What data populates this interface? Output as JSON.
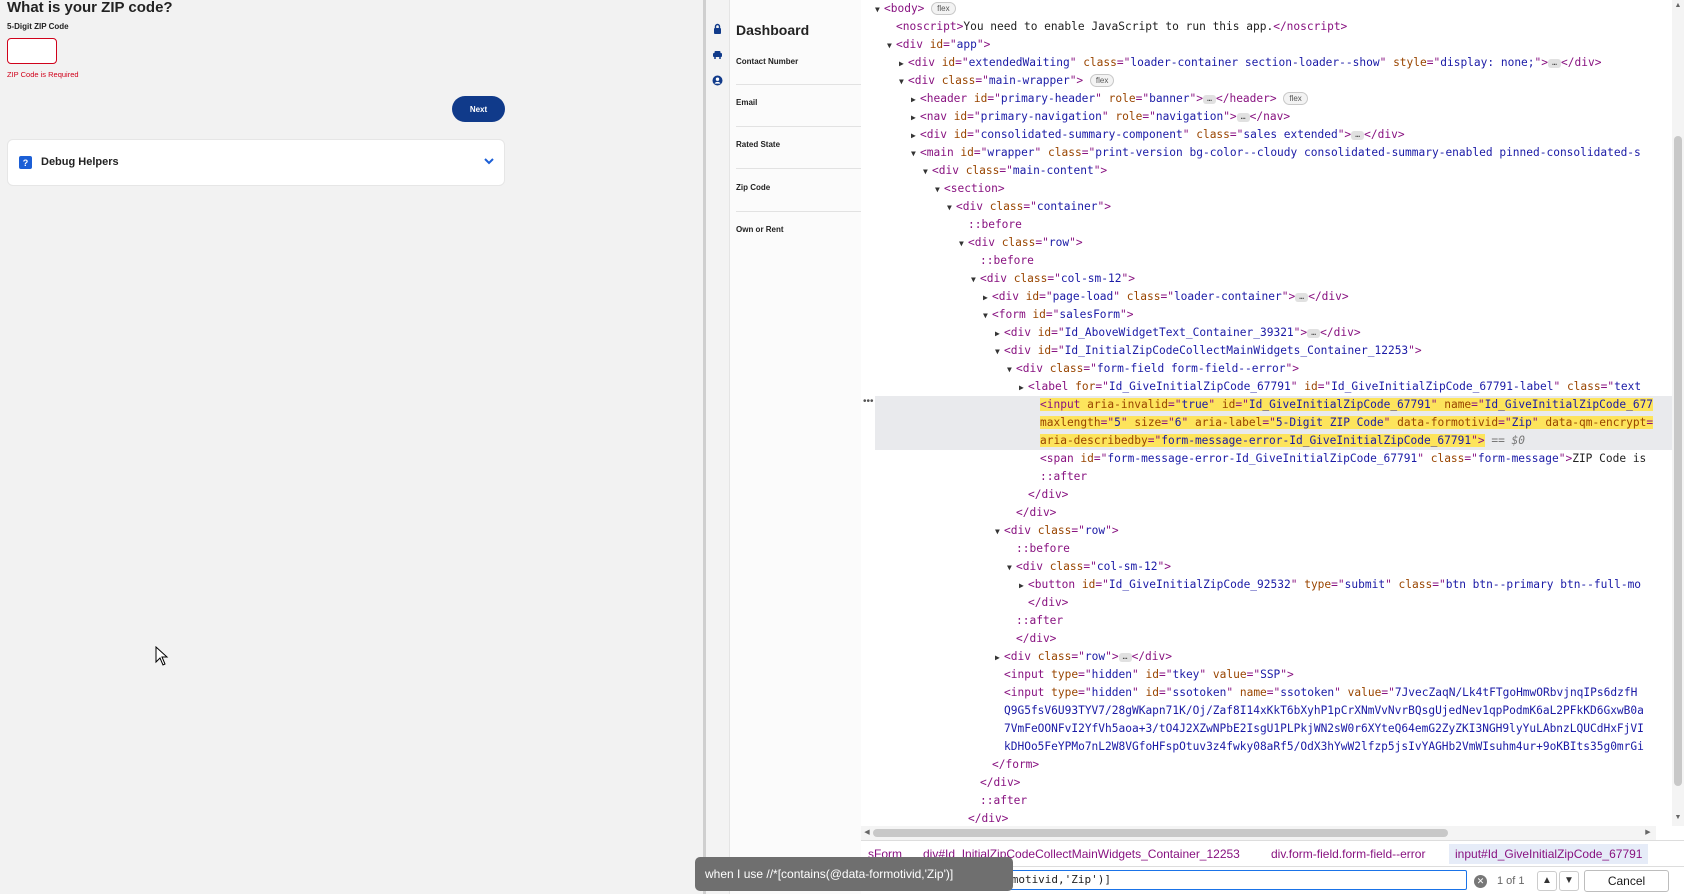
{
  "zip_form": {
    "title": "What is your ZIP code?",
    "field_label": "5-Digit ZIP Code",
    "input_value": "",
    "error_text": "ZIP Code is Required",
    "next_label": "Next",
    "debug_label": "Debug Helpers",
    "debug_icon_glyph": "?"
  },
  "dashboard": {
    "title": "Dashboard",
    "items": [
      "Contact Number",
      "Email",
      "Rated State",
      "Zip Code",
      "Own or Rent"
    ]
  },
  "devtools": {
    "dom_lines": [
      {
        "indent": 0,
        "tri": "▼",
        "html": "<span class='t-tag'>&lt;body&gt;</span> <span class='badge'>flex</span>"
      },
      {
        "indent": 1,
        "tri": "",
        "html": "<span class='t-tag'>&lt;noscript&gt;</span><span class='t-text'>You need to enable JavaScript to run this app.</span><span class='t-tag'>&lt;/noscript&gt;</span>"
      },
      {
        "indent": 1,
        "tri": "▼",
        "html": "<span class='t-tag'>&lt;div </span><span class='t-attr'>id</span><span class='t-tag'>=\"</span><span class='t-val'>app</span><span class='t-tag'>\"&gt;</span>"
      },
      {
        "indent": 2,
        "tri": "▶",
        "html": "<span class='t-tag'>&lt;div </span><span class='t-attr'>id</span><span class='t-tag'>=\"</span><span class='t-val'>extendedWaiting</span><span class='t-tag'>\" </span><span class='t-attr'>class</span><span class='t-tag'>=\"</span><span class='t-val'>loader-container section-loader--show</span><span class='t-tag'>\" </span><span class='t-attr'>style</span><span class='t-tag'>=\"</span><span class='t-val'>display: none;</span><span class='t-tag'>\"&gt;</span><span class='ell'>…</span><span class='t-tag'>&lt;/div&gt;</span>"
      },
      {
        "indent": 2,
        "tri": "▼",
        "html": "<span class='t-tag'>&lt;div </span><span class='t-attr'>class</span><span class='t-tag'>=\"</span><span class='t-val'>main-wrapper</span><span class='t-tag'>\"&gt;</span> <span class='badge'>flex</span>"
      },
      {
        "indent": 3,
        "tri": "▶",
        "html": "<span class='t-tag'>&lt;header </span><span class='t-attr'>id</span><span class='t-tag'>=\"</span><span class='t-val'>primary-header</span><span class='t-tag'>\" </span><span class='t-attr'>role</span><span class='t-tag'>=\"</span><span class='t-val'>banner</span><span class='t-tag'>\"&gt;</span><span class='ell'>…</span><span class='t-tag'>&lt;/header&gt;</span> <span class='badge'>flex</span>"
      },
      {
        "indent": 3,
        "tri": "▶",
        "html": "<span class='t-tag'>&lt;nav </span><span class='t-attr'>id</span><span class='t-tag'>=\"</span><span class='t-val'>primary-navigation</span><span class='t-tag'>\" </span><span class='t-attr'>role</span><span class='t-tag'>=\"</span><span class='t-val'>navigation</span><span class='t-tag'>\"&gt;</span><span class='ell'>…</span><span class='t-tag'>&lt;/nav&gt;</span>"
      },
      {
        "indent": 3,
        "tri": "▶",
        "html": "<span class='t-tag'>&lt;div </span><span class='t-attr'>id</span><span class='t-tag'>=\"</span><span class='t-val'>consolidated-summary-component</span><span class='t-tag'>\" </span><span class='t-attr'>class</span><span class='t-tag'>=\"</span><span class='t-val'>sales extended</span><span class='t-tag'>\"&gt;</span><span class='ell'>…</span><span class='t-tag'>&lt;/div&gt;</span>"
      },
      {
        "indent": 3,
        "tri": "▼",
        "html": "<span class='t-tag'>&lt;main </span><span class='t-attr'>id</span><span class='t-tag'>=\"</span><span class='t-val'>wrapper</span><span class='t-tag'>\" </span><span class='t-attr'>class</span><span class='t-tag'>=\"</span><span class='t-val'>print-version bg-color--cloudy consolidated-summary-enabled pinned-consolidated-s</span>"
      },
      {
        "indent": 4,
        "tri": "▼",
        "html": "<span class='t-tag'>&lt;div </span><span class='t-attr'>class</span><span class='t-tag'>=\"</span><span class='t-val'>main-content</span><span class='t-tag'>\"&gt;</span>"
      },
      {
        "indent": 5,
        "tri": "▼",
        "html": "<span class='t-tag'>&lt;section&gt;</span>"
      },
      {
        "indent": 6,
        "tri": "▼",
        "html": "<span class='t-tag'>&lt;div </span><span class='t-attr'>class</span><span class='t-tag'>=\"</span><span class='t-val'>container</span><span class='t-tag'>\"&gt;</span>"
      },
      {
        "indent": 7,
        "tri": "",
        "html": "<span class='t-pseudo'>::before</span>"
      },
      {
        "indent": 7,
        "tri": "▼",
        "html": "<span class='t-tag'>&lt;div </span><span class='t-attr'>class</span><span class='t-tag'>=\"</span><span class='t-val'>row</span><span class='t-tag'>\"&gt;</span>"
      },
      {
        "indent": 8,
        "tri": "",
        "html": "<span class='t-pseudo'>::before</span>"
      },
      {
        "indent": 8,
        "tri": "▼",
        "html": "<span class='t-tag'>&lt;div </span><span class='t-attr'>class</span><span class='t-tag'>=\"</span><span class='t-val'>col-sm-12</span><span class='t-tag'>\"&gt;</span>"
      },
      {
        "indent": 9,
        "tri": "▶",
        "html": "<span class='t-tag'>&lt;div </span><span class='t-attr'>id</span><span class='t-tag'>=\"</span><span class='t-val'>page-load</span><span class='t-tag'>\" </span><span class='t-attr'>class</span><span class='t-tag'>=\"</span><span class='t-val'>loader-container</span><span class='t-tag'>\"&gt;</span><span class='ell'>…</span><span class='t-tag'>&lt;/div&gt;</span>"
      },
      {
        "indent": 9,
        "tri": "▼",
        "html": "<span class='t-tag'>&lt;form </span><span class='t-attr'>id</span><span class='t-tag'>=\"</span><span class='t-val'>salesForm</span><span class='t-tag'>\"&gt;</span>"
      },
      {
        "indent": 10,
        "tri": "▶",
        "html": "<span class='t-tag'>&lt;div </span><span class='t-attr'>id</span><span class='t-tag'>=\"</span><span class='t-val'>Id_AboveWidgetText_Container_39321</span><span class='t-tag'>\"&gt;</span><span class='ell'>…</span><span class='t-tag'>&lt;/div&gt;</span>"
      },
      {
        "indent": 10,
        "tri": "▼",
        "html": "<span class='t-tag'>&lt;div </span><span class='t-attr'>id</span><span class='t-tag'>=\"</span><span class='t-val'>Id_InitialZipCodeCollectMainWidgets_Container_12253</span><span class='t-tag'>\"&gt;</span>"
      },
      {
        "indent": 11,
        "tri": "▼",
        "html": "<span class='t-tag'>&lt;div </span><span class='t-attr'>class</span><span class='t-tag'>=\"</span><span class='t-val'>form-field form-field--error</span><span class='t-tag'>\"&gt;</span>"
      },
      {
        "indent": 12,
        "tri": "▶",
        "html": "<span class='t-tag'>&lt;label </span><span class='t-attr'>for</span><span class='t-tag'>=\"</span><span class='t-val'>Id_GiveInitialZipCode_67791</span><span class='t-tag'>\" </span><span class='t-attr'>id</span><span class='t-tag'>=\"</span><span class='t-val'>Id_GiveInitialZipCode_67791-label</span><span class='t-tag'>\" </span><span class='t-attr'>class</span><span class='t-tag'>=\"</span><span class='t-val'>text</span>"
      },
      {
        "indent": 13,
        "tri": "",
        "sel": true,
        "html": "<span class='hl'><span class='t-tag'>&lt;input </span><span class='t-attr'>aria-invalid</span><span class='t-tag'>=\"</span><span class='t-val'>true</span><span class='t-tag'>\" </span><span class='t-attr'>id</span><span class='t-tag'>=\"</span><span class='t-val'>Id_GiveInitialZipCode_67791</span><span class='t-tag'>\" </span><span class='t-attr'>name</span><span class='t-tag'>=\"</span><span class='t-val'>Id_GiveInitialZipCode_677</span></span>"
      },
      {
        "indent": 13,
        "tri": "",
        "sel": true,
        "html": "<span class='hl'><span class='t-attr'>maxlength</span><span class='t-tag'>=\"</span><span class='t-val'>5</span><span class='t-tag'>\" </span><span class='t-attr'>size</span><span class='t-tag'>=\"</span><span class='t-val'>6</span><span class='t-tag'>\" </span><span class='t-attr'>aria-label</span><span class='t-tag'>=\"</span><span class='t-val'>5-Digit ZIP Code</span><span class='t-tag'>\" </span><span class='t-attr'>data-formotivid</span><span class='t-tag'>=\"</span><span class='t-val'>Zip</span><span class='t-tag'>\" </span><span class='t-attr'>data-qm-encrypt</span><span class='t-tag'>=</span></span>"
      },
      {
        "indent": 13,
        "tri": "",
        "sel": true,
        "html": "<span class='hl'><span class='t-attr'>aria-describedby</span><span class='t-tag'>=\"</span><span class='t-val'>form-message-error-Id_GiveInitialZipCode_67791</span><span class='t-tag'>\"&gt;</span></span> <span class='t-eq'>== $0</span>"
      },
      {
        "indent": 13,
        "tri": "",
        "html": "<span class='t-tag'>&lt;span </span><span class='t-attr'>id</span><span class='t-tag'>=\"</span><span class='t-val'>form-message-error-Id_GiveInitialZipCode_67791</span><span class='t-tag'>\" </span><span class='t-attr'>class</span><span class='t-tag'>=\"</span><span class='t-val'>form-message</span><span class='t-tag'>\"&gt;</span><span class='t-text'>ZIP Code is</span>"
      },
      {
        "indent": 13,
        "tri": "",
        "html": "<span class='t-pseudo'>::after</span>"
      },
      {
        "indent": 12,
        "tri": "",
        "html": "<span class='t-tag'>&lt;/div&gt;</span>"
      },
      {
        "indent": 11,
        "tri": "",
        "html": "<span class='t-tag'>&lt;/div&gt;</span>"
      },
      {
        "indent": 10,
        "tri": "▼",
        "html": "<span class='t-tag'>&lt;div </span><span class='t-attr'>class</span><span class='t-tag'>=\"</span><span class='t-val'>row</span><span class='t-tag'>\"&gt;</span>"
      },
      {
        "indent": 11,
        "tri": "",
        "html": "<span class='t-pseudo'>::before</span>"
      },
      {
        "indent": 11,
        "tri": "▼",
        "html": "<span class='t-tag'>&lt;div </span><span class='t-attr'>class</span><span class='t-tag'>=\"</span><span class='t-val'>col-sm-12</span><span class='t-tag'>\"&gt;</span>"
      },
      {
        "indent": 12,
        "tri": "▶",
        "html": "<span class='t-tag'>&lt;button </span><span class='t-attr'>id</span><span class='t-tag'>=\"</span><span class='t-val'>Id_GiveInitialZipCode_92532</span><span class='t-tag'>\" </span><span class='t-attr'>type</span><span class='t-tag'>=\"</span><span class='t-val'>submit</span><span class='t-tag'>\" </span><span class='t-attr'>class</span><span class='t-tag'>=\"</span><span class='t-val'>btn btn--primary btn--full-mo</span>"
      },
      {
        "indent": 12,
        "tri": "",
        "html": "<span class='t-tag'>&lt;/div&gt;</span>"
      },
      {
        "indent": 11,
        "tri": "",
        "html": "<span class='t-pseudo'>::after</span>"
      },
      {
        "indent": 11,
        "tri": "",
        "html": "<span class='t-tag'>&lt;/div&gt;</span>"
      },
      {
        "indent": 10,
        "tri": "▶",
        "html": "<span class='t-tag'>&lt;div </span><span class='t-attr'>class</span><span class='t-tag'>=\"</span><span class='t-val'>row</span><span class='t-tag'>\"&gt;</span><span class='ell'>…</span><span class='t-tag'>&lt;/div&gt;</span>"
      },
      {
        "indent": 10,
        "tri": "",
        "html": "<span class='t-tag'>&lt;input </span><span class='t-attr'>type</span><span class='t-tag'>=\"</span><span class='t-val'>hidden</span><span class='t-tag'>\" </span><span class='t-attr'>id</span><span class='t-tag'>=\"</span><span class='t-val'>tkey</span><span class='t-tag'>\" </span><span class='t-attr'>value</span><span class='t-tag'>=\"</span><span class='t-val'>SSP</span><span class='t-tag'>\"&gt;</span>"
      },
      {
        "indent": 10,
        "tri": "",
        "html": "<span class='t-tag'>&lt;input </span><span class='t-attr'>type</span><span class='t-tag'>=\"</span><span class='t-val'>hidden</span><span class='t-tag'>\" </span><span class='t-attr'>id</span><span class='t-tag'>=\"</span><span class='t-val'>ssotoken</span><span class='t-tag'>\" </span><span class='t-attr'>name</span><span class='t-tag'>=\"</span><span class='t-val'>ssotoken</span><span class='t-tag'>\" </span><span class='t-attr'>value</span><span class='t-tag'>=\"</span><span class='t-val'>7JvecZaqN/Lk4tFTgoHmwORbvjnqIPs6dzfH</span>"
      },
      {
        "indent": 10,
        "tri": "",
        "html": "<span class='t-val'>Q9G5fsV6U93TYV7/28gWKapn71K/Oj/Zaf8I14xKkT6bXyhP1pCrXNmVvNvrBQsgUjedNev1qpPodmK6aL2PFkKD6GxwB0a</span>"
      },
      {
        "indent": 10,
        "tri": "",
        "html": "<span class='t-val'>7VmFeOONFvI2YfVh5aoa+3/tO4J2XZwNPbE2IsgU1PLPkjWN2sW0r6XYteQ64emG2ZyZKI3NGH9lyYuLAbnzLQUCdHxFjVI</span>"
      },
      {
        "indent": 10,
        "tri": "",
        "html": "<span class='t-val'>kDHOo5FeYPMo7nL2W8VGfoHFspOtuv3z4fwky08aRf5/OdX3hYwW2lfzp5jsIvYAGHb2VmWIsuhm4ur+9oKBIts35g0mrGi</span>"
      },
      {
        "indent": 9,
        "tri": "",
        "html": "<span class='t-tag'>&lt;/form&gt;</span>"
      },
      {
        "indent": 8,
        "tri": "",
        "html": "<span class='t-tag'>&lt;/div&gt;</span>"
      },
      {
        "indent": 8,
        "tri": "",
        "html": "<span class='t-pseudo'>::after</span>"
      },
      {
        "indent": 7,
        "tri": "",
        "html": "<span class='t-tag'>&lt;/div&gt;</span>"
      }
    ],
    "breadcrumbs": [
      "sForm",
      "div#Id_InitialZipCodeCollectMainWidgets_Container_12253",
      "div.form-field.form-field--error",
      "input#Id_GiveInitialZipCode_67791"
    ],
    "search_value": "//*[contains(@data-formotivid,'Zip')]",
    "match_count": "1 of 1",
    "cancel_label": "Cancel"
  },
  "tooltip": {
    "text": "when I use //*[contains(@data-formotivid,'Zip')]"
  }
}
